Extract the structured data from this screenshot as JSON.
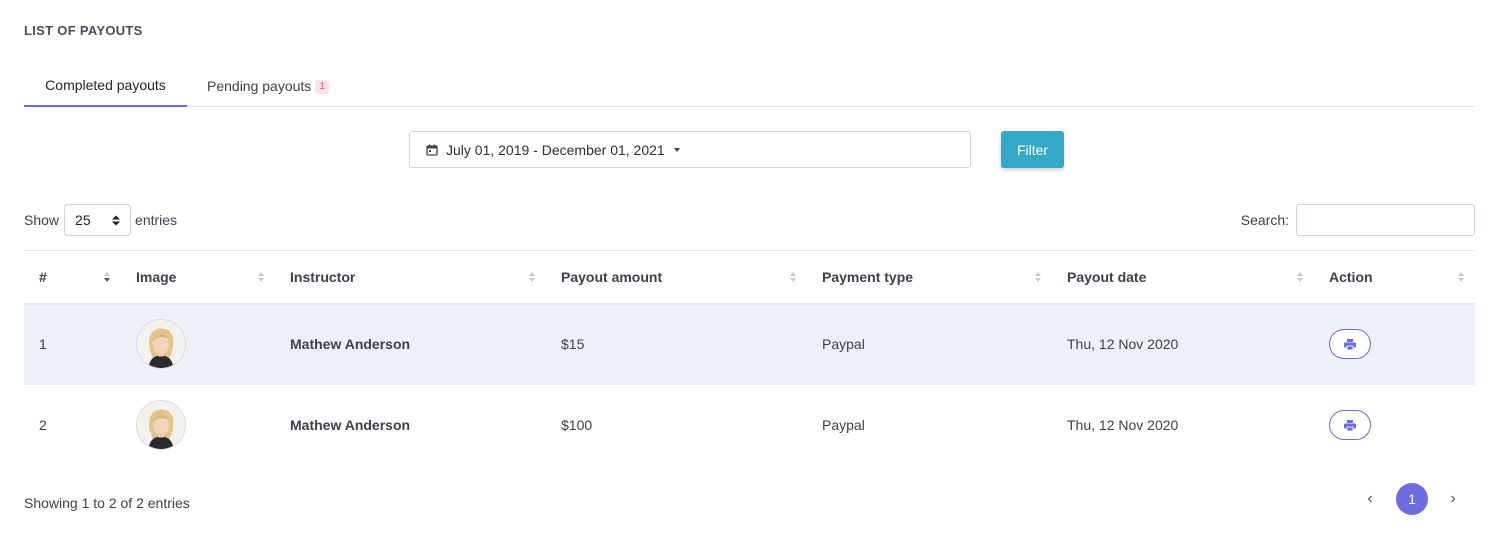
{
  "page": {
    "title": "LIST OF PAYOUTS"
  },
  "tabs": [
    {
      "label": "Completed payouts",
      "active": true
    },
    {
      "label": "Pending payouts",
      "badge": "1",
      "active": false
    }
  ],
  "filter": {
    "date_range": "July 01, 2019 - December 01, 2021",
    "button_label": "Filter",
    "calendar_icon": "calendar-icon",
    "accent_color": "#34a8c7"
  },
  "length": {
    "show_label": "Show",
    "value": "25",
    "entries_label": "entries"
  },
  "search": {
    "label": "Search:",
    "value": ""
  },
  "table": {
    "columns": [
      "#",
      "Image",
      "Instructor",
      "Payout amount",
      "Payment type",
      "Payout date",
      "Action"
    ],
    "rows": [
      {
        "num": "1",
        "instructor": "Mathew Anderson",
        "amount": "$15",
        "payment_type": "Paypal",
        "date": "Thu, 12 Nov 2020",
        "action_icon": "print-icon"
      },
      {
        "num": "2",
        "instructor": "Mathew Anderson",
        "amount": "$100",
        "payment_type": "Paypal",
        "date": "Thu, 12 Nov 2020",
        "action_icon": "print-icon"
      }
    ]
  },
  "footer": {
    "info": "Showing 1 to 2 of 2 entries",
    "prev": "‹",
    "current_page": "1",
    "next": "›"
  },
  "colors": {
    "tab_active": "#6c6cd9",
    "page_active": "#6c6cdf",
    "row_highlight": "#edf0f8",
    "badge_bg": "#fde3e6",
    "badge_text": "#e25a6a"
  }
}
